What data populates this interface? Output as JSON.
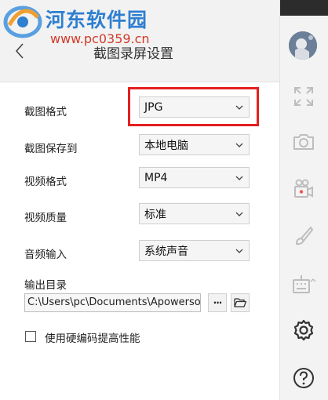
{
  "watermark": {
    "title": "河东软件园",
    "url": "www.pc0359.cn"
  },
  "header": {
    "title": "截图录屏设置"
  },
  "settings": {
    "screenshot_format": {
      "label": "截图格式",
      "value": "JPG"
    },
    "screenshot_save_to": {
      "label": "截图保存到",
      "value": "本地电脑"
    },
    "video_format": {
      "label": "视频格式",
      "value": "MP4"
    },
    "video_quality": {
      "label": "视频质量",
      "value": "标准"
    },
    "audio_input": {
      "label": "音频输入",
      "value": "系统声音"
    },
    "output_dir": {
      "label": "输出目录",
      "value": "C:\\Users\\pc\\Documents\\Apowersoft",
      "more_button": "···"
    },
    "hardware_encoding": {
      "label": "使用硬编码提高性能",
      "checked": false
    }
  },
  "rail": {
    "items": [
      "avatar",
      "fullscreen-icon",
      "camera-icon",
      "video-camera-icon",
      "brush-icon",
      "keyboard-icon",
      "gear-icon",
      "help-icon"
    ]
  },
  "colors": {
    "highlight": "#e61f1f",
    "header_bg": "#f2f2f2",
    "rail_bg": "#f3f3f3",
    "watermark_blue": "#2f7fd0",
    "watermark_red": "#d23a2a"
  }
}
